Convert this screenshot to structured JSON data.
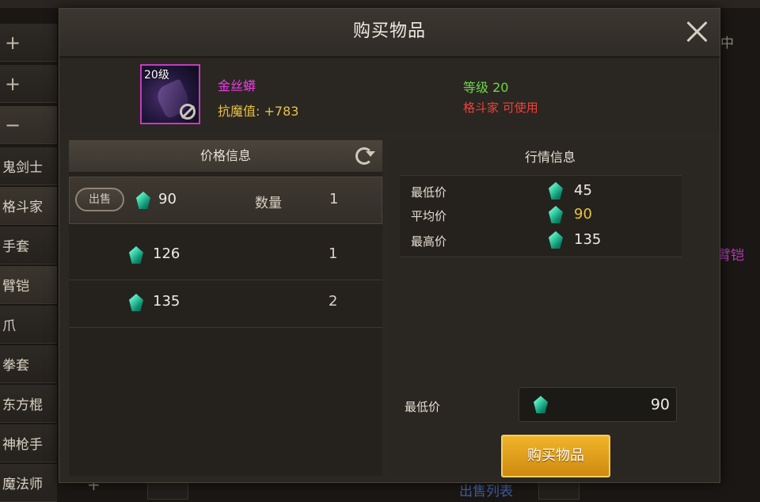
{
  "background": {
    "sidebar": [
      "+",
      "+",
      "−",
      "鬼剑士",
      "格斗家",
      "手套",
      "臂铠",
      "爪",
      "拳套",
      "东方棍",
      "神枪手",
      "魔法师"
    ],
    "right_tab": "中",
    "right_item": "臂铠",
    "bottom_list_label": "出售列表",
    "bottom_plus": "+"
  },
  "dialog": {
    "title": "购买物品",
    "item": {
      "level_badge": "20级",
      "name": "金丝蟒",
      "stat": "抗魔值: +783",
      "required_level": "等级 20",
      "required_class": "格斗家 可使用",
      "name_color": "#e640e0"
    },
    "price_panel": {
      "title": "价格信息",
      "sell_button": "出售",
      "quantity_label": "数量",
      "rows": [
        {
          "price": "90",
          "qty": "1"
        },
        {
          "price": "126",
          "qty": "1"
        },
        {
          "price": "135",
          "qty": "2"
        }
      ]
    },
    "market_panel": {
      "title": "行情信息",
      "stats": [
        {
          "label": "最低价",
          "value": "45"
        },
        {
          "label": "平均价",
          "value": "90"
        },
        {
          "label": "最高价",
          "value": "135"
        }
      ],
      "min_price_label": "最低价",
      "min_price_value": "90",
      "buy_button": "购买物品"
    }
  },
  "icons": {
    "currency": "gem-icon",
    "close": "close-icon",
    "refresh": "refresh-icon",
    "restricted": "no-trade-icon"
  },
  "colors": {
    "accent_gold": "#e8c240",
    "level_green": "#6fd84a",
    "class_red": "#f0413a",
    "buy_button": "#e6a21d"
  }
}
